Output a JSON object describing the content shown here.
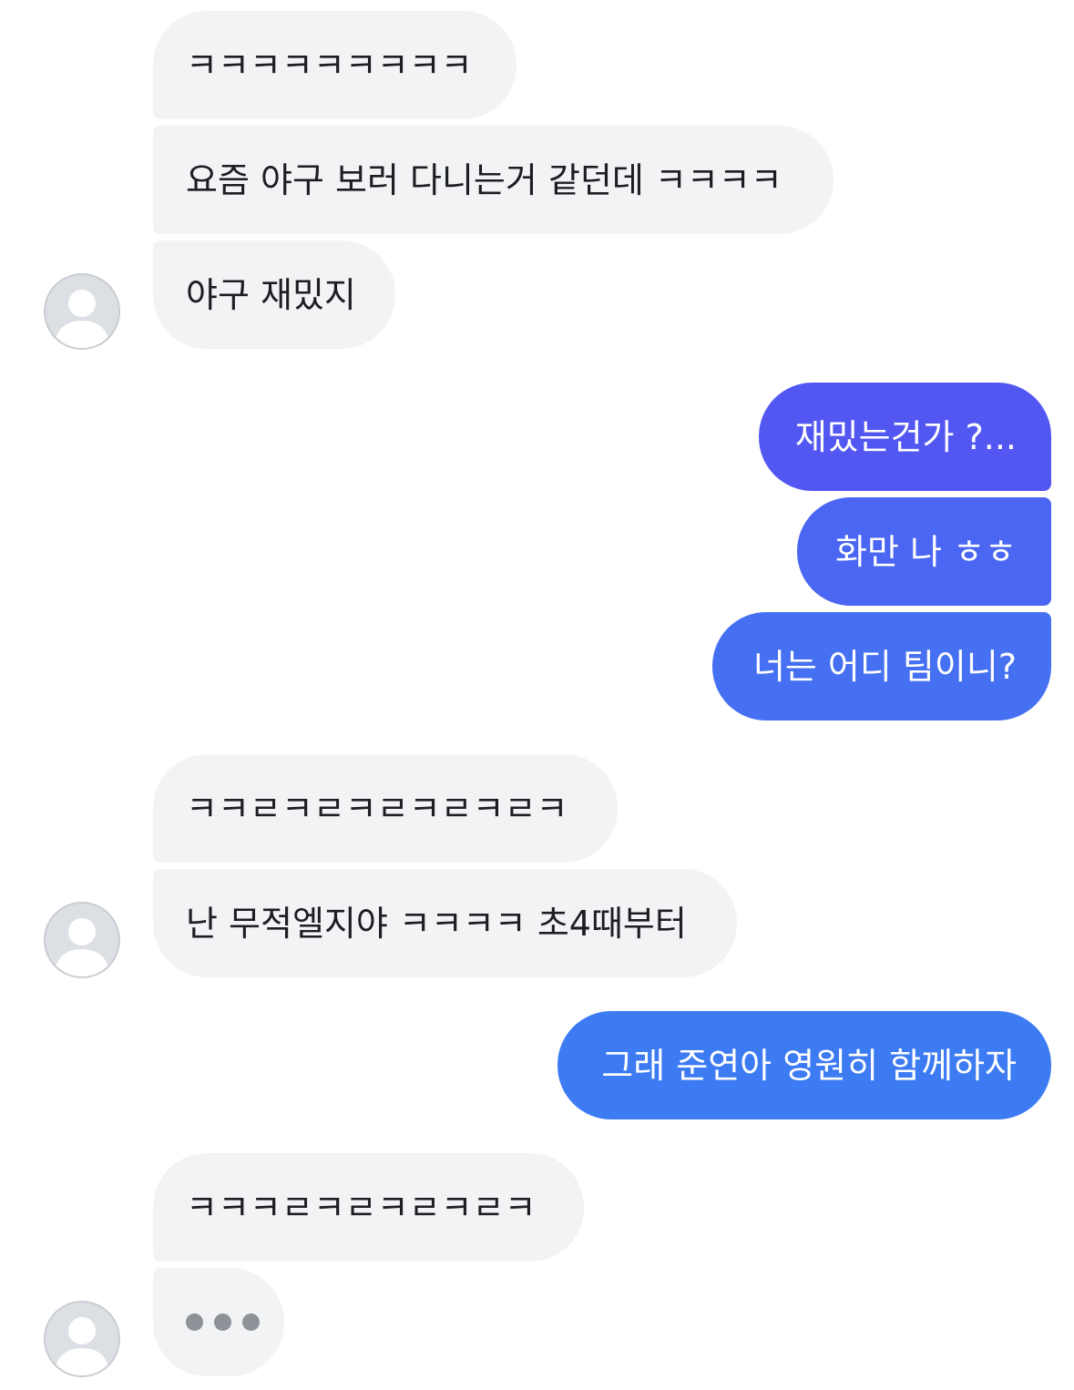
{
  "colors": {
    "incoming_bg": "#f2f3f5",
    "incoming_text": "#1c1e21",
    "outgoing_top": "#5357f2",
    "outgoing_middle": "#4a66f2",
    "outgoing_bottom": "#3d7bf3",
    "typing_dot": "#8e9198"
  },
  "messages": [
    {
      "sender": "other",
      "text": "ㅋㅋㅋㅋㅋㅋㅋㅋㅋ"
    },
    {
      "sender": "other",
      "text": "요즘 야구 보러 다니는거 같던데 ㅋㅋㅋㅋ"
    },
    {
      "sender": "other",
      "text": "야구 재밌지"
    },
    {
      "sender": "me",
      "text": "재밌는건가 ?..."
    },
    {
      "sender": "me",
      "text": "화만 나 ㅎㅎ"
    },
    {
      "sender": "me",
      "text": "너는 어디 팀이니?"
    },
    {
      "sender": "other",
      "text": "ㅋㅋㄹㅋㄹㅋㄹㅋㄹㅋㄹㅋ"
    },
    {
      "sender": "other",
      "text": "난 무적엘지야 ㅋㅋㅋㅋ 초4때부터"
    },
    {
      "sender": "me",
      "text": "그래 준연아 영원히 함께하자"
    },
    {
      "sender": "other",
      "text": "ㅋㅋㅋㄹㅋㄹㅋㄹㅋㄹㅋ"
    }
  ],
  "typing_indicator": {
    "visible": true,
    "dot_count": 3
  },
  "avatars": [
    {
      "icon": "default-profile-avatar-icon"
    },
    {
      "icon": "default-profile-avatar-icon"
    },
    {
      "icon": "default-profile-avatar-icon"
    }
  ]
}
